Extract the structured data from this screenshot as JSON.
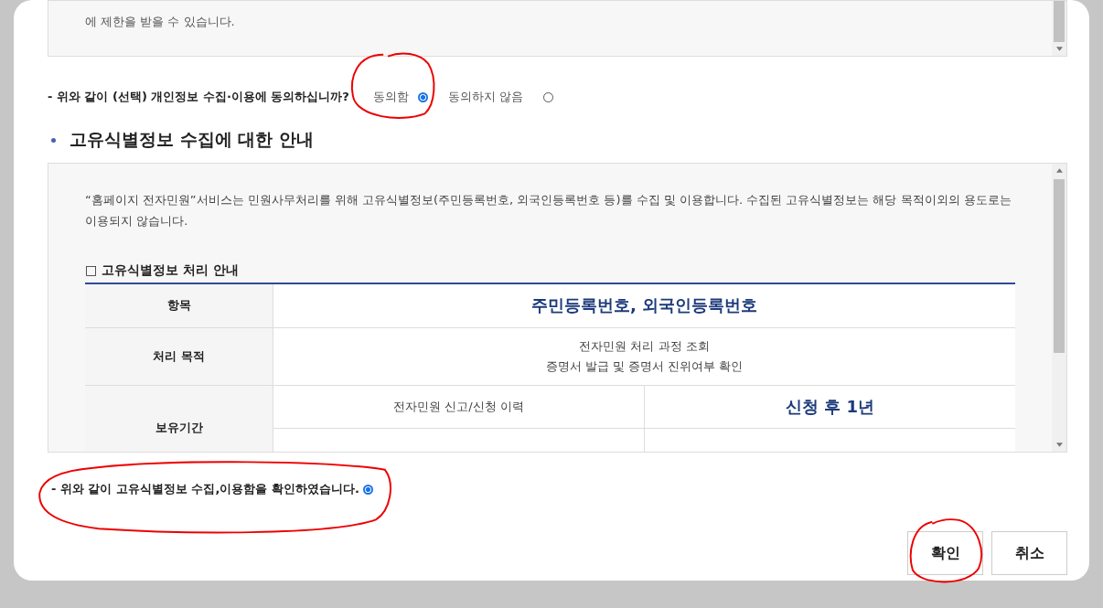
{
  "top_notice": {
    "text": "에 제한을 받을 수 있습니다."
  },
  "consent_question": {
    "label": "- 위와 같이 (선택) 개인정보 수집·이용에 동의하십니까?",
    "options": [
      {
        "label": "동의함",
        "selected": true
      },
      {
        "label": "동의하지 않음",
        "selected": false
      }
    ]
  },
  "section_title": "고유식별정보 수집에 대한 안내",
  "info": {
    "paragraph": "“홈페이지 전자민원”서비스는 민원사무처리를 위해 고유식별정보(주민등록번호, 외국인등록번호 등)를 수집 및 이용합니다. 수집된 고유식별정보는 해당 목적이외의 용도로는 이용되지 않습니다.",
    "subheading": "□ 고유식별정보 처리 안내",
    "rows": [
      {
        "kind": "single",
        "header": "항목",
        "value": "주민등록번호, 외국인등록번호"
      },
      {
        "kind": "lines",
        "header": "처리 목적",
        "lines": [
          "전자민원 처리 과정 조회",
          "증명서 발급 및 증명서 진위여부 확인"
        ]
      },
      {
        "kind": "split",
        "header": "보유기간",
        "items": [
          {
            "item": "전자민원 신고/신청 이력",
            "period": "신청 후 1년"
          }
        ]
      }
    ]
  },
  "confirm": {
    "label": "- 위와 같이 고유식별정보 수집,이용함을 확인하였습니다.",
    "checked": true
  },
  "buttons": [
    {
      "label": "확인"
    },
    {
      "label": "취소"
    }
  ]
}
